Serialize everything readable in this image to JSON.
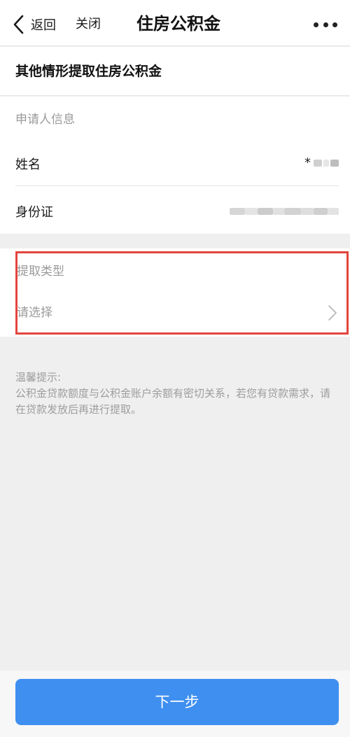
{
  "nav": {
    "back_label": "返回",
    "close_label": "关闭",
    "title": "住房公积金",
    "more_icon": "more-dots-icon"
  },
  "page_heading": "其他情形提取住房公积金",
  "applicant": {
    "section_label": "申请人信息",
    "name_label": "姓名",
    "name_value": "*",
    "id_label": "身份证"
  },
  "withdrawal": {
    "label": "提取类型",
    "placeholder": "请选择"
  },
  "tips": {
    "title": "温馨提示:",
    "body": "公积金贷款额度与公积金账户余额有密切关系，若您有贷款需求，请在贷款发放后再进行提取。"
  },
  "footer": {
    "next_label": "下一步"
  },
  "colors": {
    "primary": "#3f8ff1",
    "highlight": "#e2453c",
    "muted_text": "#9a9a9a",
    "background": "#efefef"
  }
}
